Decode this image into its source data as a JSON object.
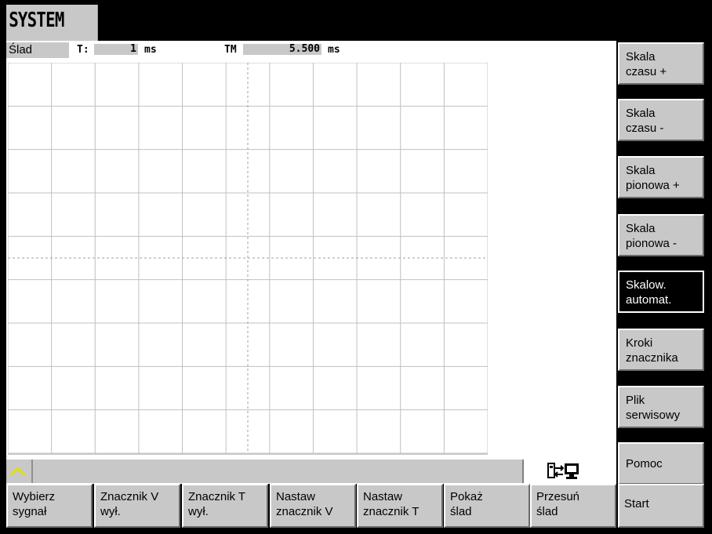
{
  "header": {
    "title": "SYSTEM"
  },
  "trace": {
    "label": "Ślad",
    "t_label": "T:",
    "t_value": "1",
    "t_unit": "ms",
    "tm_label": "TM",
    "tm_value": "5.500",
    "tm_unit": "ms"
  },
  "vertical_softkeys": [
    {
      "label": "Skala\nczasu +"
    },
    {
      "label": "Skala\nczasu -"
    },
    {
      "label": "Skala\npionowa +"
    },
    {
      "label": "Skala\npionowa -"
    },
    {
      "label": "Skalow.\nautomat."
    },
    {
      "label": "Kroki\nznacznika"
    },
    {
      "label": "Plik\nserwisowy"
    },
    {
      "label": "Pomoc"
    }
  ],
  "horizontal_softkeys": [
    {
      "label": "Wybierz\nsygnał"
    },
    {
      "label": "Znacznik V\nwył."
    },
    {
      "label": "Znacznik T\nwył."
    },
    {
      "label": "Nastaw\nznacznik V"
    },
    {
      "label": "Nastaw\nznacznik T"
    },
    {
      "label": "Pokaż\nślad"
    },
    {
      "label": "Przesuń\nślad"
    },
    {
      "label": "Start"
    }
  ],
  "colors": {
    "panel": "#c8c8c8",
    "grid_line": "#c0c0c0",
    "active_softkey_bg": "#000000",
    "arrow": "#e0e000"
  },
  "icons": {
    "recall": "up-arrow-icon",
    "status": "network-status-icon"
  }
}
